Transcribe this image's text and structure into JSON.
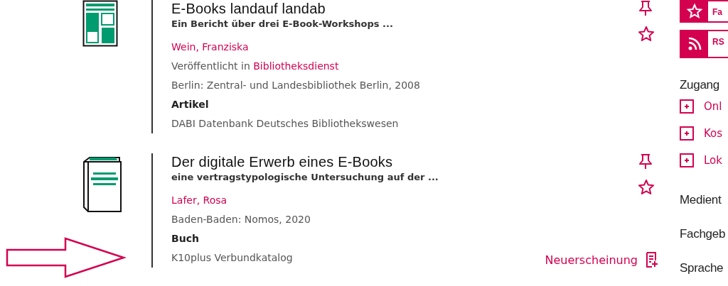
{
  "records": [
    {
      "title": "E-Books landauf landab",
      "subtitle": "Ein Bericht über drei E-Book-Workshops ...",
      "author": "Wein, Franziska",
      "published": {
        "prefix": "Veröffentlicht in",
        "link": "Bibliotheksdienst"
      },
      "imprint": "Berlin: Zentral- und Landesbibliothek Berlin, 2008",
      "format": "Artikel",
      "kind": "article",
      "source": "DABI Datenbank Deutsches Bibliothekswesen"
    },
    {
      "title": "Der digitale Erwerb eines E-Books",
      "subtitle": "eine vertragstypologische Untersuchung auf der ...",
      "author": "Lafer, Rosa",
      "imprint": "Baden-Baden: Nomos, 2020",
      "format": "Buch",
      "kind": "book",
      "source": "K10plus Verbundkatalog",
      "badge": "Neuerscheinung"
    }
  ],
  "sidebar": {
    "buttons": [
      {
        "label": "Fa",
        "kind": "favorite"
      },
      {
        "label": "RS",
        "kind": "rss"
      }
    ],
    "sections": [
      {
        "heading": "Zugang",
        "items": [
          "Onl",
          "Kos",
          "Lok"
        ]
      },
      {
        "heading": "Medient"
      },
      {
        "heading": "Fachgeb"
      },
      {
        "heading": "Sprache"
      }
    ]
  }
}
